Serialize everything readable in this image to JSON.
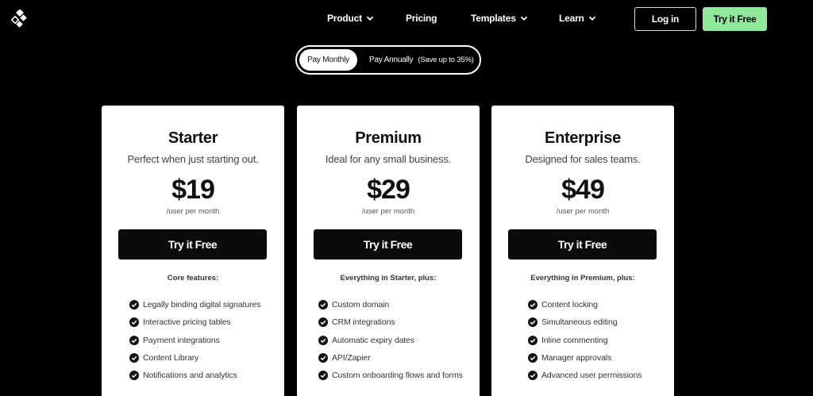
{
  "header": {
    "logo_icon": "diamond-cluster-logo-icon",
    "nav": [
      {
        "label": "Product",
        "has_dropdown": true
      },
      {
        "label": "Pricing",
        "has_dropdown": false
      },
      {
        "label": "Templates",
        "has_dropdown": true
      },
      {
        "label": "Learn",
        "has_dropdown": true
      }
    ],
    "login_label": "Log in",
    "try_free_label": "Try it Free"
  },
  "billing_toggle": {
    "monthly_label": "Pay Monthly",
    "annual_label": "Pay Annually",
    "annual_savings": "(Save up to 35%)",
    "selected": "monthly"
  },
  "plans": [
    {
      "name": "Starter",
      "description": "Perfect when just starting out.",
      "price": "$19",
      "unit": "/user per month",
      "cta": "Try it Free",
      "features_heading": "Core features:",
      "features": [
        "Legally binding digital signatures",
        "Interactive pricing tables",
        "Payment integrations",
        "Content Library",
        "Notifications and analytics"
      ]
    },
    {
      "name": "Premium",
      "description": "Ideal for any small business.",
      "price": "$29",
      "unit": "/user per month",
      "cta": "Try it Free",
      "features_heading": "Everything in Starter, plus:",
      "features": [
        "Custom domain",
        "CRM integrations",
        "Automatic expiry dates",
        "API/Zapier",
        "Custom onboarding flows and forms"
      ]
    },
    {
      "name": "Enterprise",
      "description": "Designed for sales teams.",
      "price": "$49",
      "unit": "/user per month",
      "cta": "Try it Free",
      "features_heading": "Everything in Premium, plus:",
      "features": [
        "Content locking",
        "Simultaneous editing",
        "Inline commenting",
        "Manager approvals",
        "Advanced user permissions"
      ]
    }
  ],
  "colors": {
    "background": "#000000",
    "accent_green": "#8ee99a",
    "card": "#ffffff",
    "cta": "#0b0b0b"
  }
}
